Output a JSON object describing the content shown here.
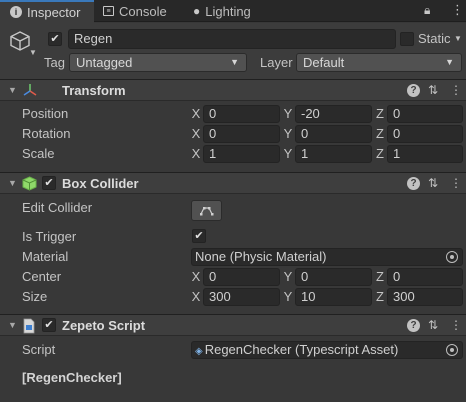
{
  "tabs": [
    {
      "label": "Inspector",
      "icon": "info-icon",
      "active": true
    },
    {
      "label": "Console",
      "icon": "console-icon",
      "active": false
    },
    {
      "label": "Lighting",
      "icon": "lightbulb-icon",
      "active": false
    }
  ],
  "object": {
    "name": "Regen",
    "active": true,
    "static_label": "Static",
    "static_checked": false,
    "tag_label": "Tag",
    "tag_value": "Untagged",
    "layer_label": "Layer",
    "layer_value": "Default"
  },
  "transform": {
    "title": "Transform",
    "rows": [
      {
        "label": "Position",
        "x": "0",
        "y": "-20",
        "z": "0"
      },
      {
        "label": "Rotation",
        "x": "0",
        "y": "0",
        "z": "0"
      },
      {
        "label": "Scale",
        "x": "1",
        "y": "1",
        "z": "1"
      }
    ]
  },
  "box_collider": {
    "title": "Box Collider",
    "enabled": true,
    "edit_collider_label": "Edit Collider",
    "is_trigger_label": "Is Trigger",
    "is_trigger": true,
    "material_label": "Material",
    "material_value": "None (Physic Material)",
    "center_label": "Center",
    "center": {
      "x": "0",
      "y": "0",
      "z": "0"
    },
    "size_label": "Size",
    "size": {
      "x": "300",
      "y": "10",
      "z": "300"
    }
  },
  "zepeto_script": {
    "title": "Zepeto Script",
    "enabled": true,
    "script_label": "Script",
    "script_value": "RegenChecker (Typescript Asset)",
    "class_label": "[RegenChecker]"
  },
  "axes": {
    "x": "X",
    "y": "Y",
    "z": "Z"
  },
  "colors": {
    "tab_accent": "#3a79bb",
    "panel_bg": "#383838",
    "field_bg": "#2a2a2a"
  }
}
